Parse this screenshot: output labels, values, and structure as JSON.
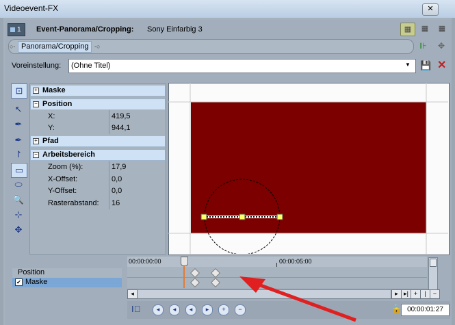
{
  "window": {
    "title": "Videoevent-FX",
    "close_label": "✕"
  },
  "effect": {
    "index": "1",
    "name": "Event-Panorama/Cropping:",
    "media": "Sony Einfarbig 3"
  },
  "chain": {
    "chip_label": "Panorama/Cropping"
  },
  "preset": {
    "label": "Voreinstellung:",
    "value": "(Ohne Titel)"
  },
  "properties": {
    "sections": {
      "maske": "Maske",
      "position": "Position",
      "pfad": "Pfad",
      "arbeitsbereich": "Arbeitsbereich"
    },
    "position": {
      "x_label": "X:",
      "x_value": "419,5",
      "y_label": "Y:",
      "y_value": "944,1"
    },
    "arbeitsbereich": {
      "zoom_label": "Zoom (%):",
      "zoom_value": "17,9",
      "xoff_label": "X-Offset:",
      "xoff_value": "0,0",
      "yoff_label": "Y-Offset:",
      "yoff_value": "0,0",
      "raster_label": "Rasterabstand:",
      "raster_value": "16"
    }
  },
  "timeline": {
    "tracks": [
      "Position",
      "Maske"
    ],
    "ruler": {
      "start": "00:00:00:00",
      "mark": "00:00:05:00"
    },
    "timecode": "00:00:01:27"
  },
  "colors": {
    "canvas_fill": "#7c0000",
    "annotation_arrow": "#e02020",
    "playhead": "#e47a33"
  }
}
